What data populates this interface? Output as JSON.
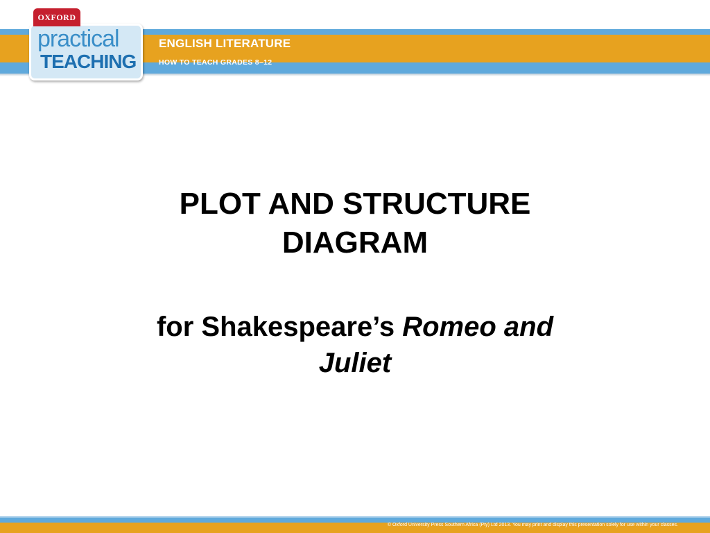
{
  "header": {
    "publisher": "OXFORD",
    "series_line1": "practical",
    "series_line2": "TEACHING",
    "subject": "ENGLISH LITERATURE",
    "grades": "HOW TO TEACH GRADES 8–12"
  },
  "slide": {
    "title_line1": "PLOT AND STRUCTURE",
    "title_line2": "DIAGRAM",
    "subtitle_plain": "for Shakespeare’s",
    "subtitle_italic_1": "Romeo and",
    "subtitle_italic_2": "Juliet"
  },
  "footer": {
    "copyright": "© Oxford University Press Southern Africa (Pty) Ltd 2013. You may print and display this presentation solely for use within your classes."
  },
  "colors": {
    "banner_gold": "#e7a21f",
    "banner_blue": "#5fa9dc",
    "oxford_red": "#c51f2e"
  }
}
